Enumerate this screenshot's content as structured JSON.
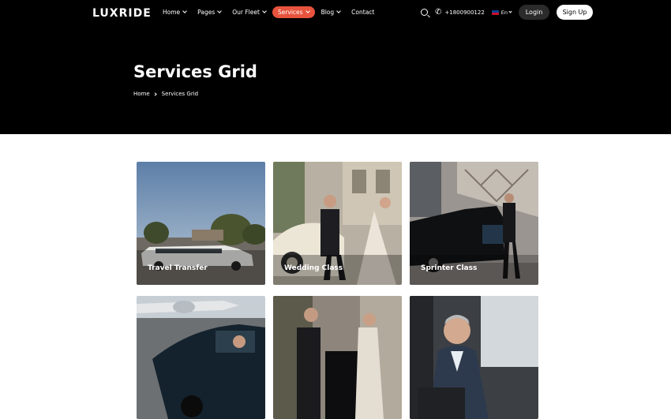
{
  "brand": {
    "name": "LUXRIDE"
  },
  "nav": {
    "items": [
      {
        "label": "Home",
        "chevron": true,
        "active": false
      },
      {
        "label": "Pages",
        "chevron": true,
        "active": false
      },
      {
        "label": "Our Fleet",
        "chevron": true,
        "active": false
      },
      {
        "label": "Services",
        "chevron": true,
        "active": true
      },
      {
        "label": "Blog",
        "chevron": true,
        "active": false
      },
      {
        "label": "Contact",
        "chevron": false,
        "active": false
      }
    ],
    "phone": "+1800900122",
    "language": "En",
    "login_label": "Login",
    "signup_label": "Sign Up"
  },
  "hero": {
    "title": "Services Grid",
    "breadcrumb": [
      "Home",
      "Services Grid"
    ]
  },
  "services": [
    {
      "label": "Travel Transfer",
      "icon": "limousine-photo"
    },
    {
      "label": "Wedding Class",
      "icon": "wedding-couple-photo"
    },
    {
      "label": "Sprinter Class",
      "icon": "sedan-luggage-photo"
    },
    {
      "label": "",
      "icon": "airport-car-photo"
    },
    {
      "label": "",
      "icon": "chauffeur-couple-photo"
    },
    {
      "label": "",
      "icon": "business-passenger-photo"
    }
  ],
  "colors": {
    "accent": "#e8533d",
    "hero_bg": "#000000"
  }
}
